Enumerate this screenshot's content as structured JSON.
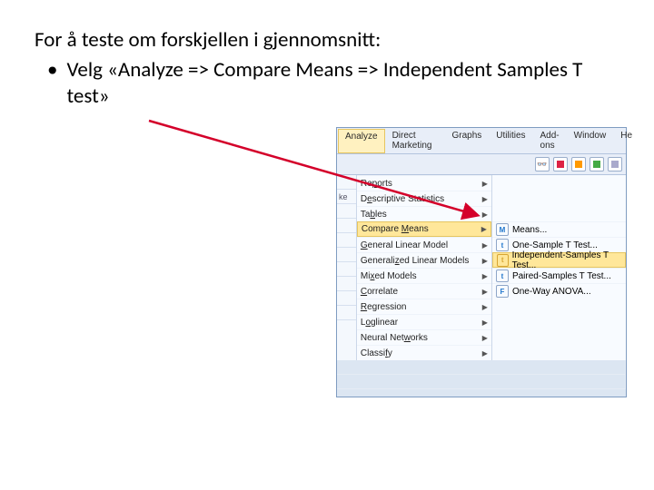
{
  "slide": {
    "heading": "For å teste om forskjellen i gjennomsnitt:",
    "bullet_dot": "•",
    "bullet_text": "Velg «Analyze => Compare Means => Independent Samples T test»"
  },
  "menubar": {
    "items": [
      "Analyze",
      "Direct Marketing",
      "Graphs",
      "Utilities",
      "Add-ons",
      "Window",
      "He"
    ]
  },
  "grid_left": {
    "labels": [
      "",
      "ke",
      "",
      "",
      "",
      "",
      "",
      "",
      "",
      ""
    ]
  },
  "analyze_menu": {
    "items": [
      {
        "label_pre": "Re",
        "u": "p",
        "label_post": "orts",
        "arrow": true
      },
      {
        "label_pre": "D",
        "u": "e",
        "label_post": "scriptive Statistics",
        "arrow": true
      },
      {
        "label_pre": "Ta",
        "u": "b",
        "label_post": "les",
        "arrow": true
      },
      {
        "label_pre": "Compare ",
        "u": "M",
        "label_post": "eans",
        "arrow": true,
        "highlight": true
      },
      {
        "label_pre": "",
        "u": "G",
        "label_post": "eneral Linear Model",
        "arrow": true
      },
      {
        "label_pre": "Generali",
        "u": "z",
        "label_post": "ed Linear Models",
        "arrow": true
      },
      {
        "label_pre": "Mi",
        "u": "x",
        "label_post": "ed Models",
        "arrow": true
      },
      {
        "label_pre": "",
        "u": "C",
        "label_post": "orrelate",
        "arrow": true
      },
      {
        "label_pre": "",
        "u": "R",
        "label_post": "egression",
        "arrow": true
      },
      {
        "label_pre": "L",
        "u": "o",
        "label_post": "glinear",
        "arrow": true
      },
      {
        "label_pre": "Neural Net",
        "u": "w",
        "label_post": "orks",
        "arrow": true
      },
      {
        "label_pre": "Classi",
        "u": "f",
        "label_post": "y",
        "arrow": true
      }
    ]
  },
  "submenu": {
    "items": [
      {
        "icon": "M",
        "cls": "blue",
        "label_pre": "",
        "u": "M",
        "label_post": "eans..."
      },
      {
        "icon": "t",
        "cls": "blue",
        "label_pre": "One-",
        "u": "S",
        "label_post": "ample T Test..."
      },
      {
        "icon": "t",
        "cls": "gold",
        "label_pre": "Independen",
        "u": "t",
        "label_post": "-Samples T Test...",
        "highlight": true
      },
      {
        "icon": "t",
        "cls": "blue",
        "label_pre": "",
        "u": "P",
        "label_post": "aired-Samples T Test..."
      },
      {
        "icon": "F",
        "cls": "blue",
        "label_pre": "",
        "u": "O",
        "label_post": "ne-Way ANOVA..."
      }
    ]
  }
}
